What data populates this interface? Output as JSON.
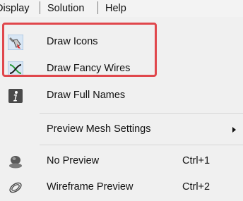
{
  "menubar": {
    "items": [
      {
        "label": "Display"
      },
      {
        "label": "Solution"
      },
      {
        "label": "Help"
      }
    ]
  },
  "menu": {
    "items": [
      {
        "label": "Draw Icons",
        "icon": "brush-icon"
      },
      {
        "label": "Draw Fancy Wires",
        "icon": "fancy-wires-icon"
      },
      {
        "label": "Draw Full Names",
        "icon": "info-icon"
      },
      {
        "label": "Preview Mesh Settings",
        "has_submenu": true
      },
      {
        "label": "No Preview",
        "shortcut": "Ctrl+1",
        "icon": "no-preview-icon"
      },
      {
        "label": "Wireframe Preview",
        "shortcut": "Ctrl+2",
        "icon": "wireframe-preview-icon"
      }
    ]
  },
  "colors": {
    "highlight_border": "#e0474c",
    "menu_background": "#f0f0f0"
  }
}
